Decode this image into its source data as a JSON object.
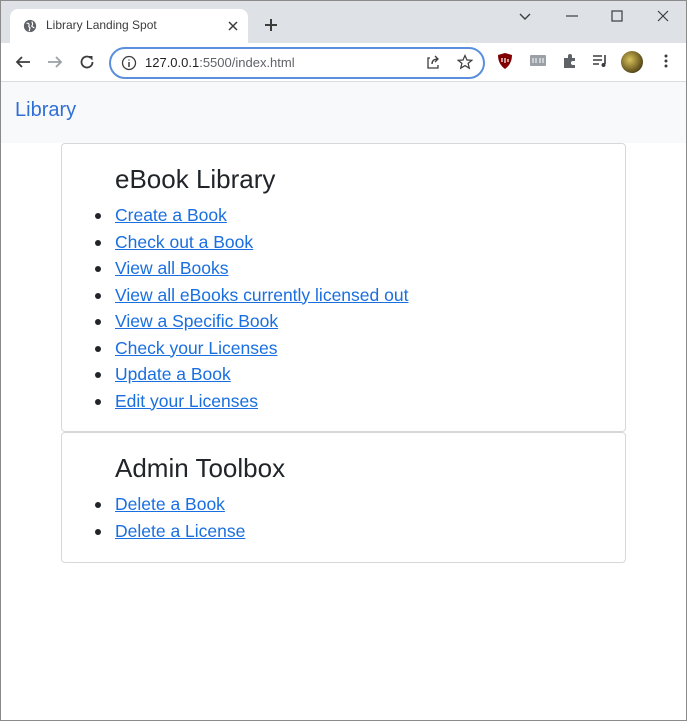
{
  "browser": {
    "tab_title": "Library Landing Spot",
    "url_host": "127.0.0.1",
    "url_rest": ":5500/index.html"
  },
  "navbar": {
    "brand": "Library"
  },
  "library_card": {
    "title": "eBook Library",
    "links": [
      "Create a Book",
      "Check out a Book",
      "View all Books",
      "View all eBooks currently licensed out",
      "View a Specific Book",
      "Check your Licenses",
      "Update a Book",
      "Edit your Licenses"
    ]
  },
  "admin_card": {
    "title": "Admin Toolbox",
    "links": [
      "Delete a Book",
      "Delete a License"
    ]
  }
}
